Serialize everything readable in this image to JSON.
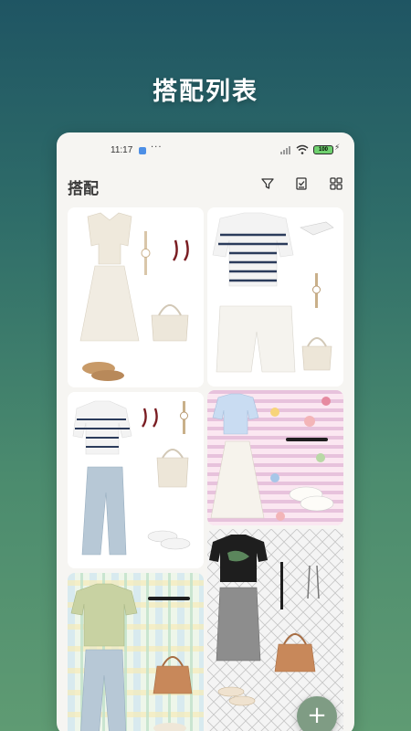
{
  "banner": {
    "title": "搭配列表"
  },
  "status_bar": {
    "time": "11:17",
    "dots": "···",
    "battery": "100"
  },
  "app_bar": {
    "title": "搭配",
    "icons": [
      "filter-icon",
      "select-icon",
      "grid-view-icon"
    ]
  },
  "fab": {
    "label": "+"
  },
  "outfit_cards": [
    {
      "name": "outfit-card-1",
      "icon": "outfit-image"
    },
    {
      "name": "outfit-card-2",
      "icon": "outfit-image"
    },
    {
      "name": "outfit-card-3",
      "icon": "outfit-image"
    },
    {
      "name": "outfit-card-4",
      "icon": "outfit-image"
    },
    {
      "name": "outfit-card-5",
      "icon": "outfit-image"
    },
    {
      "name": "outfit-card-6",
      "icon": "outfit-image"
    }
  ],
  "colors": {
    "accent": "#7f9c84",
    "banner_top": "#1f5563",
    "banner_bottom": "#5f9b73"
  }
}
